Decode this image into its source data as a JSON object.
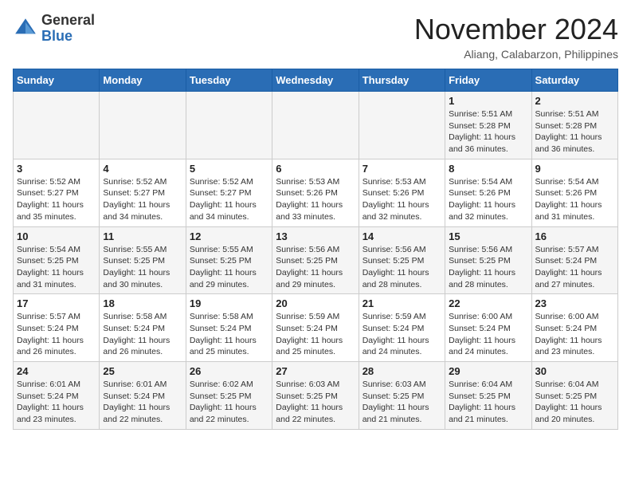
{
  "header": {
    "logo_line1": "General",
    "logo_line2": "Blue",
    "month_year": "November 2024",
    "location": "Aliang, Calabarzon, Philippines"
  },
  "weekdays": [
    "Sunday",
    "Monday",
    "Tuesday",
    "Wednesday",
    "Thursday",
    "Friday",
    "Saturday"
  ],
  "weeks": [
    [
      {
        "day": "",
        "info": ""
      },
      {
        "day": "",
        "info": ""
      },
      {
        "day": "",
        "info": ""
      },
      {
        "day": "",
        "info": ""
      },
      {
        "day": "",
        "info": ""
      },
      {
        "day": "1",
        "info": "Sunrise: 5:51 AM\nSunset: 5:28 PM\nDaylight: 11 hours and 36 minutes."
      },
      {
        "day": "2",
        "info": "Sunrise: 5:51 AM\nSunset: 5:28 PM\nDaylight: 11 hours and 36 minutes."
      }
    ],
    [
      {
        "day": "3",
        "info": "Sunrise: 5:52 AM\nSunset: 5:27 PM\nDaylight: 11 hours and 35 minutes."
      },
      {
        "day": "4",
        "info": "Sunrise: 5:52 AM\nSunset: 5:27 PM\nDaylight: 11 hours and 34 minutes."
      },
      {
        "day": "5",
        "info": "Sunrise: 5:52 AM\nSunset: 5:27 PM\nDaylight: 11 hours and 34 minutes."
      },
      {
        "day": "6",
        "info": "Sunrise: 5:53 AM\nSunset: 5:26 PM\nDaylight: 11 hours and 33 minutes."
      },
      {
        "day": "7",
        "info": "Sunrise: 5:53 AM\nSunset: 5:26 PM\nDaylight: 11 hours and 32 minutes."
      },
      {
        "day": "8",
        "info": "Sunrise: 5:54 AM\nSunset: 5:26 PM\nDaylight: 11 hours and 32 minutes."
      },
      {
        "day": "9",
        "info": "Sunrise: 5:54 AM\nSunset: 5:26 PM\nDaylight: 11 hours and 31 minutes."
      }
    ],
    [
      {
        "day": "10",
        "info": "Sunrise: 5:54 AM\nSunset: 5:25 PM\nDaylight: 11 hours and 31 minutes."
      },
      {
        "day": "11",
        "info": "Sunrise: 5:55 AM\nSunset: 5:25 PM\nDaylight: 11 hours and 30 minutes."
      },
      {
        "day": "12",
        "info": "Sunrise: 5:55 AM\nSunset: 5:25 PM\nDaylight: 11 hours and 29 minutes."
      },
      {
        "day": "13",
        "info": "Sunrise: 5:56 AM\nSunset: 5:25 PM\nDaylight: 11 hours and 29 minutes."
      },
      {
        "day": "14",
        "info": "Sunrise: 5:56 AM\nSunset: 5:25 PM\nDaylight: 11 hours and 28 minutes."
      },
      {
        "day": "15",
        "info": "Sunrise: 5:56 AM\nSunset: 5:25 PM\nDaylight: 11 hours and 28 minutes."
      },
      {
        "day": "16",
        "info": "Sunrise: 5:57 AM\nSunset: 5:24 PM\nDaylight: 11 hours and 27 minutes."
      }
    ],
    [
      {
        "day": "17",
        "info": "Sunrise: 5:57 AM\nSunset: 5:24 PM\nDaylight: 11 hours and 26 minutes."
      },
      {
        "day": "18",
        "info": "Sunrise: 5:58 AM\nSunset: 5:24 PM\nDaylight: 11 hours and 26 minutes."
      },
      {
        "day": "19",
        "info": "Sunrise: 5:58 AM\nSunset: 5:24 PM\nDaylight: 11 hours and 25 minutes."
      },
      {
        "day": "20",
        "info": "Sunrise: 5:59 AM\nSunset: 5:24 PM\nDaylight: 11 hours and 25 minutes."
      },
      {
        "day": "21",
        "info": "Sunrise: 5:59 AM\nSunset: 5:24 PM\nDaylight: 11 hours and 24 minutes."
      },
      {
        "day": "22",
        "info": "Sunrise: 6:00 AM\nSunset: 5:24 PM\nDaylight: 11 hours and 24 minutes."
      },
      {
        "day": "23",
        "info": "Sunrise: 6:00 AM\nSunset: 5:24 PM\nDaylight: 11 hours and 23 minutes."
      }
    ],
    [
      {
        "day": "24",
        "info": "Sunrise: 6:01 AM\nSunset: 5:24 PM\nDaylight: 11 hours and 23 minutes."
      },
      {
        "day": "25",
        "info": "Sunrise: 6:01 AM\nSunset: 5:24 PM\nDaylight: 11 hours and 22 minutes."
      },
      {
        "day": "26",
        "info": "Sunrise: 6:02 AM\nSunset: 5:25 PM\nDaylight: 11 hours and 22 minutes."
      },
      {
        "day": "27",
        "info": "Sunrise: 6:03 AM\nSunset: 5:25 PM\nDaylight: 11 hours and 22 minutes."
      },
      {
        "day": "28",
        "info": "Sunrise: 6:03 AM\nSunset: 5:25 PM\nDaylight: 11 hours and 21 minutes."
      },
      {
        "day": "29",
        "info": "Sunrise: 6:04 AM\nSunset: 5:25 PM\nDaylight: 11 hours and 21 minutes."
      },
      {
        "day": "30",
        "info": "Sunrise: 6:04 AM\nSunset: 5:25 PM\nDaylight: 11 hours and 20 minutes."
      }
    ]
  ]
}
